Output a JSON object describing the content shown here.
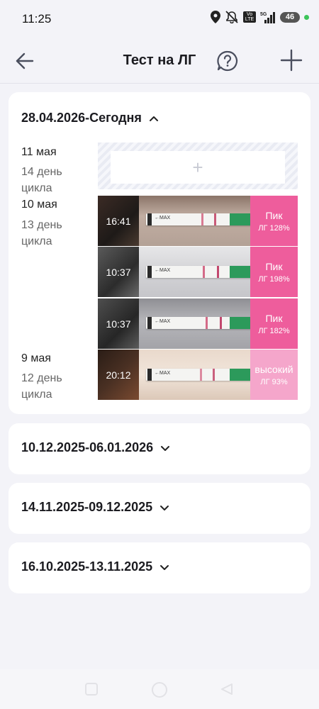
{
  "status": {
    "time": "11:25",
    "network": "5G",
    "volte": "Vo LTE",
    "battery": "46"
  },
  "header": {
    "title": "Тест на ЛГ"
  },
  "current_cycle": {
    "range": "28.04.2026-Сегодня",
    "days": [
      {
        "date": "11 мая",
        "cycle_day": "14 день цикла"
      },
      {
        "date": "10 мая",
        "cycle_day": "13 день цикла"
      },
      {
        "date": "9 мая",
        "cycle_day": "12 день цикла"
      }
    ],
    "tests": [
      {
        "time": "16:41",
        "result": "Пик",
        "lh": "ЛГ 128%",
        "color": "#ee5d9c"
      },
      {
        "time": "10:37",
        "result": "Пик",
        "lh": "ЛГ 198%",
        "color": "#ee5d9c"
      },
      {
        "time": "10:37",
        "result": "Пик",
        "lh": "ЛГ 182%",
        "color": "#ee5d9c"
      },
      {
        "time": "20:12",
        "result": "высокий",
        "lh": "ЛГ 93%",
        "color": "#f5a6cb"
      }
    ]
  },
  "past_cycles": [
    {
      "range": "10.12.2025-06.01.2026"
    },
    {
      "range": "14.11.2025-09.12.2025"
    },
    {
      "range": "16.10.2025-13.11.2025"
    }
  ],
  "icons": {
    "back": "arrow-left-icon",
    "help": "question-circle-icon",
    "add": "plus-icon",
    "expand": "chevron-up-icon",
    "collapse": "chevron-down-icon"
  }
}
